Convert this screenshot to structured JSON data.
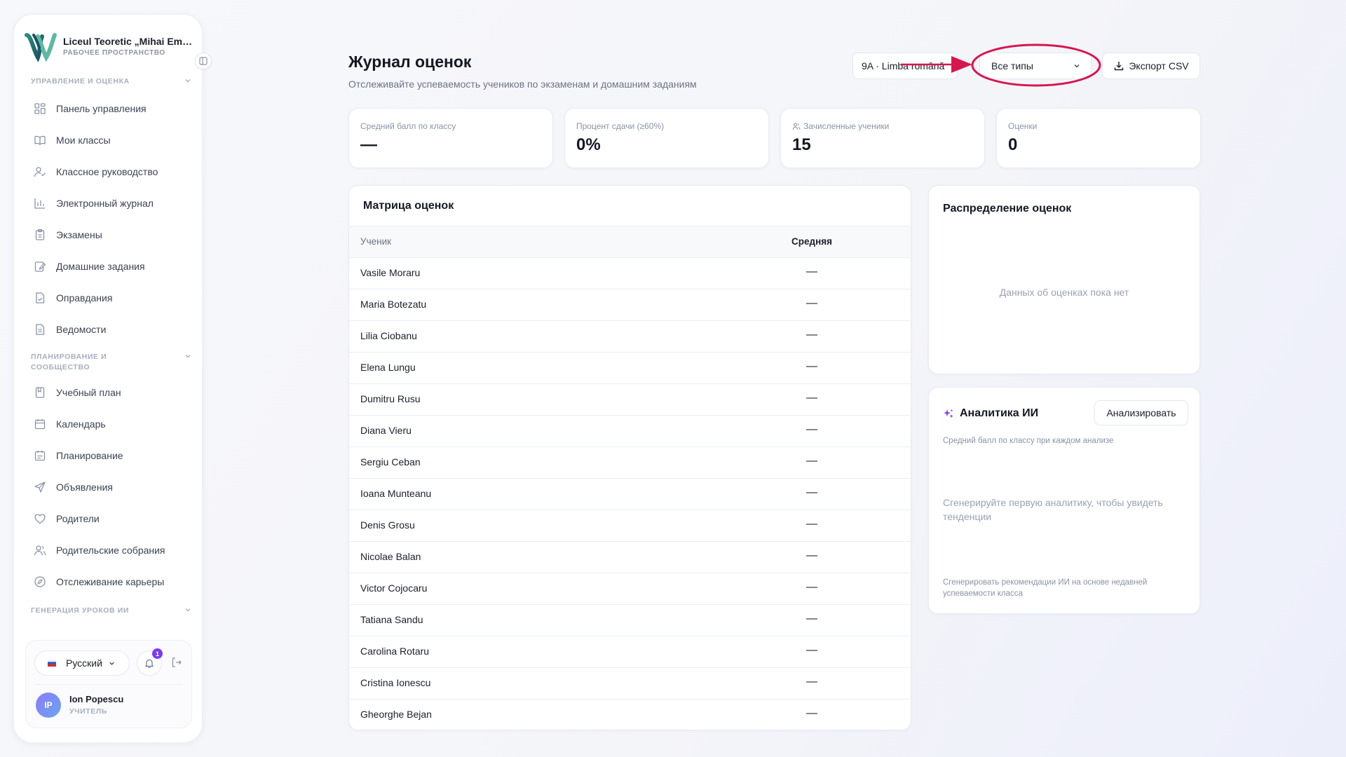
{
  "sidebar": {
    "brand_name": "Liceul Teoretic „Mihai Emi...",
    "brand_sub": "РАБОЧЕЕ ПРОСТРАНСТВО",
    "sections": [
      {
        "label": "УПРАВЛЕНИЕ И ОЦЕНКА"
      },
      {
        "label_line1": "ПЛАНИРОВАНИЕ И",
        "label_line2": "СООБЩЕСТВО"
      },
      {
        "label": "ГЕНЕРАЦИЯ УРОКОВ ИИ"
      }
    ],
    "items": [
      {
        "label": "Панель управления",
        "icon": "dashboard-icon"
      },
      {
        "label": "Мои классы",
        "icon": "book-open-icon"
      },
      {
        "label": "Классное руководство",
        "icon": "user-check-icon"
      },
      {
        "label": "Электронный журнал",
        "icon": "bar-chart-icon"
      },
      {
        "label": "Экзамены",
        "icon": "clipboard-icon"
      },
      {
        "label": "Домашние задания",
        "icon": "edit-note-icon"
      },
      {
        "label": "Оправдания",
        "icon": "file-check-icon"
      },
      {
        "label": "Ведомости",
        "icon": "file-text-icon"
      },
      {
        "label": "Учебный план",
        "icon": "notebook-icon"
      },
      {
        "label": "Календарь",
        "icon": "calendar-icon"
      },
      {
        "label": "Планирование",
        "icon": "calendar-list-icon"
      },
      {
        "label": "Объявления",
        "icon": "send-icon"
      },
      {
        "label": "Родители",
        "icon": "heart-icon"
      },
      {
        "label": "Родительские собрания",
        "icon": "users-icon"
      },
      {
        "label": "Отслеживание карьеры",
        "icon": "compass-icon"
      }
    ],
    "language": "Русский",
    "notifications_count": "1",
    "user_initials": "IP",
    "user_name": "Ion Popescu",
    "user_role": "УЧИТЕЛЬ"
  },
  "header": {
    "title": "Журнал оценок",
    "subtitle": "Отслеживайте успеваемость учеников по экзаменам и домашним заданиям",
    "class_select": "9A · Limba română",
    "type_select": "Все типы",
    "export_label": "Экспорт CSV"
  },
  "stats": [
    {
      "label": "Средний балл по классу",
      "value": "—"
    },
    {
      "label": "Процент сдачи (≥60%)",
      "value": "0%"
    },
    {
      "label": "Зачисленные ученики",
      "value": "15"
    },
    {
      "label": "Оценки",
      "value": "0"
    }
  ],
  "matrix": {
    "title": "Матрица оценок",
    "col_student": "Ученик",
    "col_average": "Средняя",
    "rows": [
      {
        "name": "Vasile Moraru",
        "avg": "—"
      },
      {
        "name": "Maria Botezatu",
        "avg": "—"
      },
      {
        "name": "Lilia Ciobanu",
        "avg": "—"
      },
      {
        "name": "Elena Lungu",
        "avg": "—"
      },
      {
        "name": "Dumitru Rusu",
        "avg": "—"
      },
      {
        "name": "Diana Vieru",
        "avg": "—"
      },
      {
        "name": "Sergiu Ceban",
        "avg": "—"
      },
      {
        "name": "Ioana Munteanu",
        "avg": "—"
      },
      {
        "name": "Denis Grosu",
        "avg": "—"
      },
      {
        "name": "Nicolae Balan",
        "avg": "—"
      },
      {
        "name": "Victor Cojocaru",
        "avg": "—"
      },
      {
        "name": "Tatiana Sandu",
        "avg": "—"
      },
      {
        "name": "Carolina Rotaru",
        "avg": "—"
      },
      {
        "name": "Cristina Ionescu",
        "avg": "—"
      },
      {
        "name": "Gheorghe Bejan",
        "avg": "—"
      }
    ]
  },
  "distribution": {
    "title": "Распределение оценок",
    "empty": "Данных об оценках пока нет"
  },
  "ai": {
    "title": "Аналитика ИИ",
    "analyze_label": "Анализировать",
    "caption": "Средний балл по классу при каждом анализе",
    "empty": "Сгенерируйте первую аналитику, чтобы увидеть тенденции",
    "footer": "Сгенерировать рекомендации ИИ на основе недавней успеваемости класса"
  },
  "colors": {
    "accent": "#7c3aed",
    "annotation": "#d6174f"
  }
}
